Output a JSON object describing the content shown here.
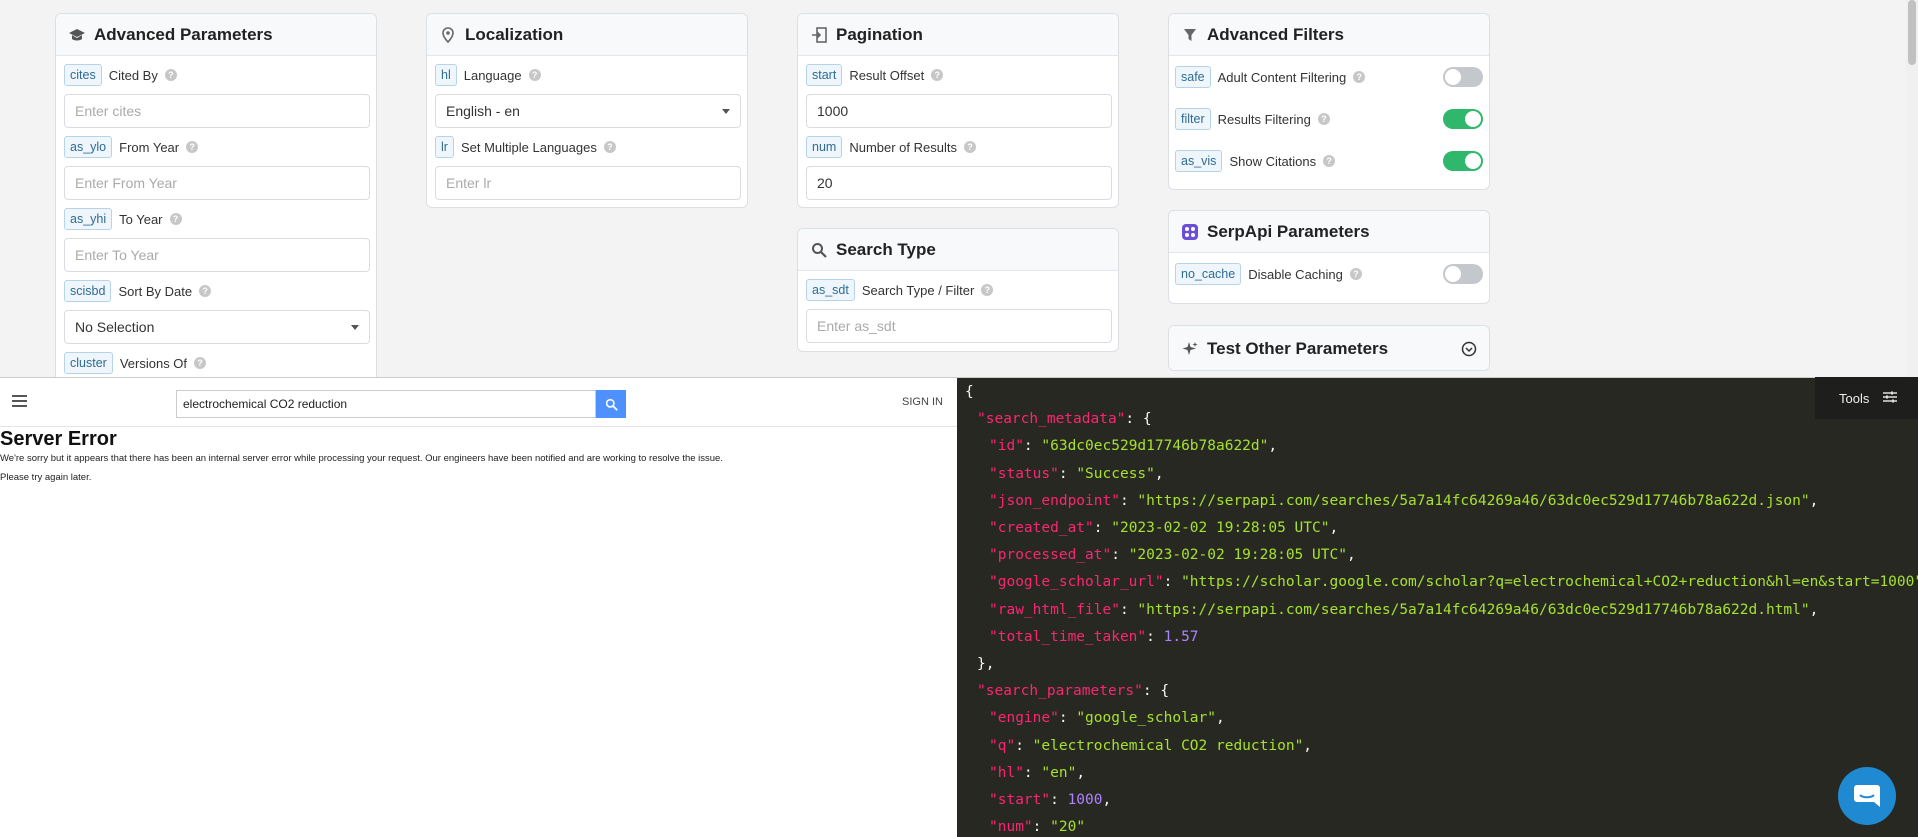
{
  "advanced_parameters": {
    "title": "Advanced Parameters",
    "params": [
      {
        "tag": "cites",
        "label": "Cited By",
        "placeholder": "Enter cites"
      },
      {
        "tag": "as_ylo",
        "label": "From Year",
        "placeholder": "Enter From Year"
      },
      {
        "tag": "as_yhi",
        "label": "To Year",
        "placeholder": "Enter To Year"
      },
      {
        "tag": "scisbd",
        "label": "Sort By Date",
        "selected": "No Selection"
      },
      {
        "tag": "cluster",
        "label": "Versions Of"
      }
    ]
  },
  "localization": {
    "title": "Localization",
    "params": [
      {
        "tag": "hl",
        "label": "Language",
        "selected": "English - en"
      },
      {
        "tag": "lr",
        "label": "Set Multiple Languages",
        "placeholder": "Enter lr"
      }
    ]
  },
  "pagination": {
    "title": "Pagination",
    "params": [
      {
        "tag": "start",
        "label": "Result Offset",
        "value": "1000"
      },
      {
        "tag": "num",
        "label": "Number of Results",
        "value": "20"
      }
    ]
  },
  "search_type": {
    "title": "Search Type",
    "params": [
      {
        "tag": "as_sdt",
        "label": "Search Type / Filter",
        "placeholder": "Enter as_sdt"
      }
    ]
  },
  "advanced_filters": {
    "title": "Advanced Filters",
    "params": [
      {
        "tag": "safe",
        "label": "Adult Content Filtering",
        "on": false
      },
      {
        "tag": "filter",
        "label": "Results Filtering",
        "on": true
      },
      {
        "tag": "as_vis",
        "label": "Show Citations",
        "on": true
      }
    ]
  },
  "serpapi_parameters": {
    "title": "SerpApi Parameters",
    "params": [
      {
        "tag": "no_cache",
        "label": "Disable Caching",
        "on": false
      }
    ]
  },
  "test_other": {
    "title": "Test Other Parameters"
  },
  "scholar": {
    "query": "electrochemical CO2 reduction",
    "sign_in": "SIGN IN",
    "error_title": "Server Error",
    "error_message": "We're sorry but it appears that there has been an internal server error while processing your request. Our engineers have been notified and are working to resolve the issue.",
    "error_retry": "Please try again later."
  },
  "json_viewer": {
    "tools_label": "Tools",
    "lines": [
      {
        "indent": 0,
        "punct": "{"
      },
      {
        "indent": 1,
        "key": "search_metadata",
        "punct": ": {"
      },
      {
        "indent": 2,
        "key": "id",
        "str": "63dc0ec529d17746b78a622d",
        "punct": ","
      },
      {
        "indent": 2,
        "key": "status",
        "str": "Success",
        "punct": ","
      },
      {
        "indent": 2,
        "key": "json_endpoint",
        "str": "https://serpapi.com/searches/5a7a14fc64269a46/63dc0ec529d17746b78a622d.json",
        "punct": ","
      },
      {
        "indent": 2,
        "key": "created_at",
        "str": "2023-02-02 19:28:05 UTC",
        "punct": ","
      },
      {
        "indent": 2,
        "key": "processed_at",
        "str": "2023-02-02 19:28:05 UTC",
        "punct": ","
      },
      {
        "indent": 2,
        "key": "google_scholar_url",
        "str": "https://scholar.google.com/scholar?q=electrochemical+CO2+reduction&hl=en&start=1000",
        "punct": ""
      },
      {
        "indent": 2,
        "key": "raw_html_file",
        "str": "https://serpapi.com/searches/5a7a14fc64269a46/63dc0ec529d17746b78a622d.html",
        "punct": ","
      },
      {
        "indent": 2,
        "key": "total_time_taken",
        "num": "1.57",
        "punct": ""
      },
      {
        "indent": 1,
        "punct": "},"
      },
      {
        "indent": 1,
        "key": "search_parameters",
        "punct": ": {"
      },
      {
        "indent": 2,
        "key": "engine",
        "str": "google_scholar",
        "punct": ","
      },
      {
        "indent": 2,
        "key": "q",
        "str": "electrochemical CO2 reduction",
        "punct": ","
      },
      {
        "indent": 2,
        "key": "hl",
        "str": "en",
        "punct": ","
      },
      {
        "indent": 2,
        "key": "start",
        "num": "1000",
        "punct": ","
      },
      {
        "indent": 2,
        "key": "num",
        "str": "20",
        "punct": ""
      }
    ]
  }
}
